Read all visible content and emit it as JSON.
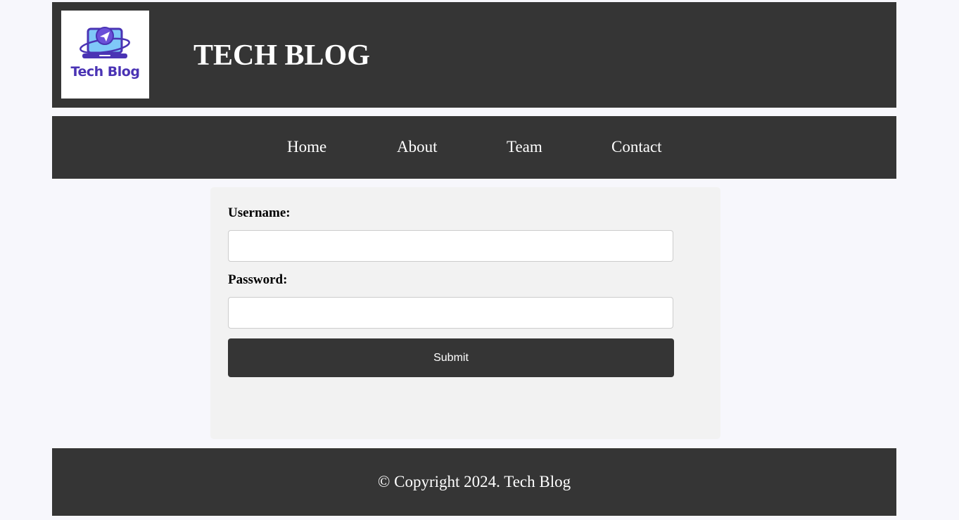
{
  "header": {
    "logo_text": "Tech Blog",
    "site_title": "TECH BLOG"
  },
  "nav": {
    "items": [
      {
        "label": "Home"
      },
      {
        "label": "About"
      },
      {
        "label": "Team"
      },
      {
        "label": "Contact"
      }
    ]
  },
  "form": {
    "username_label": "Username:",
    "username_value": "",
    "password_label": "Password:",
    "password_value": "",
    "submit_label": "Submit"
  },
  "footer": {
    "copyright": "© Copyright 2024. Tech Blog"
  },
  "colors": {
    "page_background": "#f7f7fc",
    "bar_background": "#353535",
    "form_background": "#f2f2f2",
    "logo_purple": "#4a33b4",
    "logo_blue": "#7fc8f8"
  },
  "icons": {
    "logo": "laptop-send-icon"
  }
}
